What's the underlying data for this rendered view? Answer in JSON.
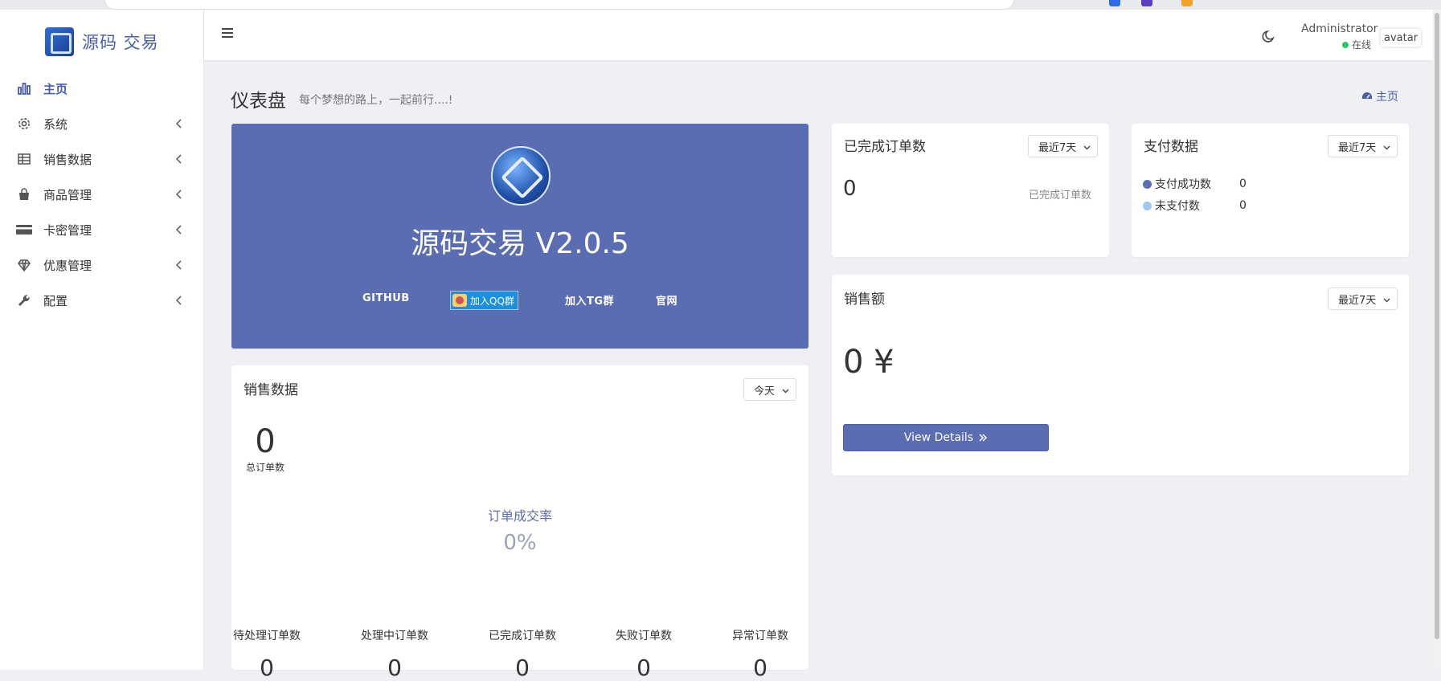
{
  "brand": {
    "name": "源码 交易"
  },
  "sidebar": {
    "items": [
      {
        "label": "主页",
        "icon": "bar-chart-icon",
        "active": true
      },
      {
        "label": "系统",
        "icon": "gear-icon"
      },
      {
        "label": "销售数据",
        "icon": "table-icon"
      },
      {
        "label": "商品管理",
        "icon": "shopping-bag-icon"
      },
      {
        "label": "卡密管理",
        "icon": "credit-card-icon"
      },
      {
        "label": "优惠管理",
        "icon": "diamond-icon"
      },
      {
        "label": "配置",
        "icon": "wrench-icon"
      }
    ]
  },
  "topbar": {
    "user_name": "Administrator",
    "status": "在线",
    "avatar_alt": "avatar"
  },
  "page": {
    "title": "仪表盘",
    "subtitle": "每个梦想的路上，一起前行....!",
    "breadcrumb": "主页"
  },
  "hero": {
    "title": "源码交易 V2.0.5",
    "links": {
      "github": "GITHUB",
      "qq": "加入QQ群",
      "tg": "加入TG群",
      "site": "官网"
    }
  },
  "completed_orders": {
    "title": "已完成订单数",
    "period": "最近7天",
    "value": "0",
    "label": "已完成订单数"
  },
  "payment": {
    "title": "支付数据",
    "period": "最近7天",
    "success_label": "支付成功数",
    "success_value": "0",
    "unpaid_label": "未支付数",
    "unpaid_value": "0",
    "colors": {
      "success": "#5a6cb2",
      "unpaid": "#9ec8f0"
    }
  },
  "sales_amount": {
    "title": "销售额",
    "period": "最近7天",
    "value": "0 ¥",
    "button": "View Details"
  },
  "sales_data": {
    "title": "销售数据",
    "period": "今天",
    "total_value": "0",
    "total_label": "总订单数",
    "rate_label": "订单成交率",
    "rate_value": "0%",
    "stats": [
      {
        "label": "待处理订单数",
        "value": "0"
      },
      {
        "label": "处理中订单数",
        "value": "0"
      },
      {
        "label": "已完成订单数",
        "value": "0"
      },
      {
        "label": "失败订单数",
        "value": "0"
      },
      {
        "label": "异常订单数",
        "value": "0"
      }
    ]
  }
}
